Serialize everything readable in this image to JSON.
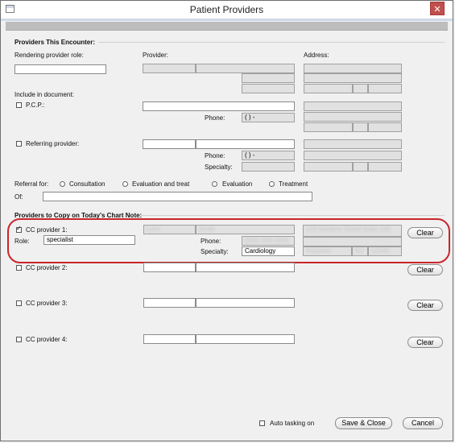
{
  "window": {
    "title": "Patient Providers",
    "close_glyph": "✕"
  },
  "encounter": {
    "section_title": "Providers This Encounter:",
    "rendering_role_label": "Rendering provider role:",
    "rendering_role_value": "",
    "provider_header": "Provider:",
    "address_header": "Address:",
    "include_label": "Include in document:",
    "pcp_label": "P.C.P.:",
    "phone_label": "Phone:",
    "phone_mask": "(    )    -",
    "referring_label": "Referring provider:",
    "specialty_label": "Specialty:",
    "referral_for_label": "Referral for:",
    "referral_options": [
      "Consultation",
      "Evaluation and treat",
      "Evaluation",
      "Treatment"
    ],
    "of_label": "Of:",
    "of_value": ""
  },
  "cc": {
    "section_title": "Providers to Copy on Today's Chart Note:",
    "provider1": {
      "label": "CC provider 1:",
      "checked": true,
      "role_label": "Role:",
      "role_value": "specialist",
      "first_name": "Lynn",
      "last_name": "Smith",
      "phone_label": "Phone:",
      "phone_value": "(555) 555-5555",
      "specialty_label": "Specialty:",
      "specialty_value": "Cardiology",
      "address_line": "123 Sesame Street Suite 100",
      "city": "Anytown",
      "state": "NJ",
      "zip": "12345"
    },
    "provider2_label": "CC provider 2:",
    "provider3_label": "CC provider 3:",
    "provider4_label": "CC provider 4:",
    "clear_label": "Clear"
  },
  "footer": {
    "auto_tasking_label": "Auto tasking on",
    "save_close_label": "Save & Close",
    "cancel_label": "Cancel"
  },
  "colors": {
    "highlight": "#c9252a",
    "title_text": "#222222",
    "close_button": "#c0504d"
  }
}
